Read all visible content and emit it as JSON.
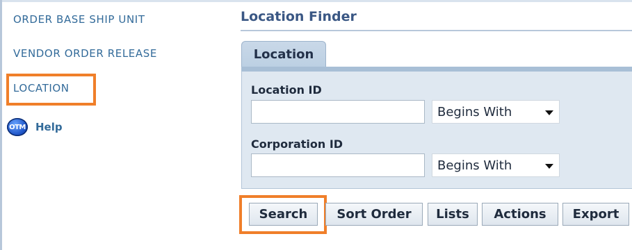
{
  "sidebar": {
    "items": [
      {
        "label": "ORDER BASE SHIP UNIT"
      },
      {
        "label": "VENDOR ORDER RELEASE"
      },
      {
        "label": "LOCATION"
      }
    ],
    "help": {
      "icon_text": "OTM",
      "label": "Help"
    }
  },
  "page": {
    "title": "Location Finder"
  },
  "tabs": [
    {
      "label": "Location"
    }
  ],
  "form": {
    "location_id": {
      "label": "Location ID",
      "value": "",
      "operator": "Begins With"
    },
    "corporation_id": {
      "label": "Corporation ID",
      "value": "",
      "operator": "Begins With"
    }
  },
  "actions": {
    "search": "Search",
    "sort_order": "Sort Order",
    "lists": "Lists",
    "actions": "Actions",
    "export": "Export"
  },
  "colors": {
    "highlight": "#f07f2a",
    "link": "#336b9a",
    "title": "#3a5784",
    "panel": "#dfe8f1"
  }
}
